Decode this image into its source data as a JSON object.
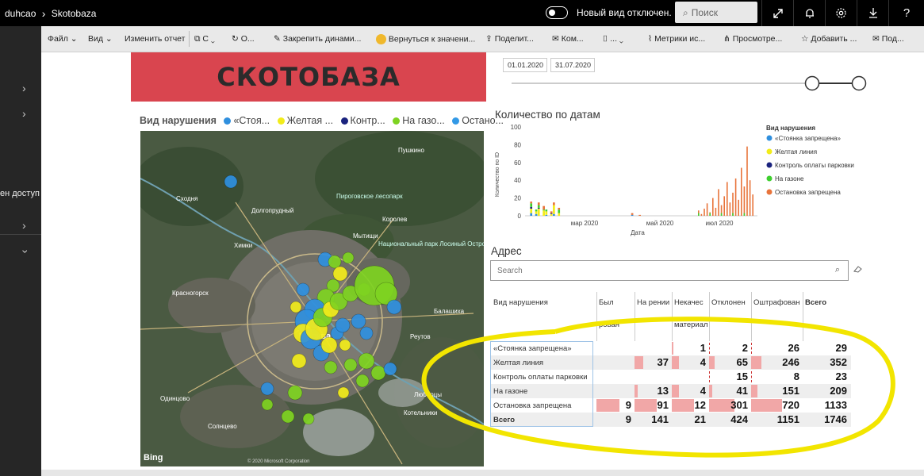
{
  "topbar": {
    "workspace": "duhcao",
    "separator": "›",
    "report": "Skotobaza",
    "toggle_label": "Новый вид отключен.",
    "search_placeholder": "Поиск"
  },
  "toolbar": {
    "items": [
      "Файл",
      "Вид",
      "Изменить отчет",
      "С",
      "О...",
      "Закрепить динами...",
      "Вернуться к значени...",
      "Поделит...",
      "Ком...",
      "...",
      "Метрики ис...",
      "Просмотре...",
      "Добавить ...",
      "Под..."
    ]
  },
  "left_rail": {
    "text": "ен доступ"
  },
  "banner": {
    "title": "СКОТОБАЗА"
  },
  "map": {
    "legend_title": "Вид нарушения",
    "legend_items": [
      "«Стоя...",
      "Желтая ...",
      "Контр...",
      "На газо...",
      "Остано..."
    ],
    "legend_colors": [
      "#2f8fde",
      "#f2ec1a",
      "#1a237e",
      "#7ed321",
      "#3399e6"
    ],
    "labels": [
      "Москва",
      "Химки",
      "Долгопрудный",
      "Мытищи",
      "Королев",
      "Пушкино",
      "Красногорск",
      "Одинцово",
      "Балашиха",
      "Реутов",
      "Люберцы",
      "Котельники",
      "Пироговское лесопарк",
      "Национальный парк Лосиный Остров",
      "Сходня",
      "Солнцево"
    ],
    "logo": "Bing",
    "copyright": "© 2020 Microsoft Corporation"
  },
  "slicer": {
    "start_date": "01.01.2020",
    "end_date": "31.07.2020"
  },
  "chart_data": {
    "type": "bar",
    "title": "Количество по датам",
    "xlabel": "Дата",
    "ylabel": "Количество по ID",
    "ylim": [
      0,
      100
    ],
    "y_ticks": [
      0,
      20,
      40,
      60,
      80,
      100
    ],
    "x_ticks": [
      "мар 2020",
      "май 2020",
      "июл 2020"
    ],
    "legend_title": "Вид нарушения",
    "legend_position": "right",
    "stacked": true,
    "series": [
      {
        "name": "«Стоянка запрещена»",
        "color": "#2f8fde",
        "values": [
          0,
          0,
          3,
          0,
          2,
          0,
          0,
          0,
          1,
          0,
          0,
          2,
          0,
          0,
          0,
          0,
          0,
          0,
          0,
          0,
          0,
          0,
          0,
          0,
          0,
          0,
          0,
          0,
          0,
          0,
          0,
          0,
          0,
          0,
          0,
          0,
          0,
          0,
          0,
          0,
          0,
          0,
          1,
          0,
          0,
          0,
          0,
          0,
          0,
          0,
          0,
          0,
          0,
          0,
          0,
          0,
          0,
          0,
          0,
          0,
          0,
          0,
          0,
          0,
          0,
          0,
          0,
          0,
          0,
          0,
          0,
          0,
          0,
          0,
          0,
          0,
          0,
          0,
          0,
          0,
          0,
          0,
          0,
          0,
          0,
          0,
          0,
          0,
          0,
          0,
          0,
          0
        ]
      },
      {
        "name": "Желтая линия",
        "color": "#f2ec1a",
        "values": [
          0,
          0,
          5,
          0,
          3,
          8,
          0,
          6,
          4,
          0,
          2,
          10,
          0,
          3,
          0,
          0,
          0,
          0,
          0,
          0,
          0,
          0,
          0,
          0,
          0,
          0,
          0,
          0,
          0,
          0,
          0,
          0,
          0,
          0,
          0,
          0,
          0,
          0,
          0,
          0,
          0,
          0,
          0,
          0,
          0,
          0,
          0,
          0,
          0,
          0,
          0,
          0,
          0,
          0,
          0,
          0,
          0,
          0,
          0,
          0,
          0,
          0,
          0,
          0,
          0,
          0,
          0,
          0,
          0,
          0,
          0,
          0,
          0,
          0,
          0,
          0,
          0,
          0,
          0,
          0,
          0,
          0,
          0,
          0,
          0,
          0,
          0,
          0,
          0,
          0,
          0,
          0
        ]
      },
      {
        "name": "Контроль оплаты парковки",
        "color": "#1a237e",
        "values": [
          0,
          0,
          2,
          0,
          0,
          1,
          0,
          0,
          0,
          0,
          1,
          0,
          0,
          0,
          0,
          0,
          0,
          0,
          0,
          0,
          0,
          0,
          0,
          0,
          0,
          0,
          0,
          0,
          0,
          0,
          0,
          0,
          0,
          0,
          0,
          0,
          0,
          0,
          0,
          0,
          0,
          0,
          0,
          0,
          0,
          0,
          0,
          0,
          0,
          0,
          0,
          0,
          0,
          0,
          0,
          0,
          0,
          0,
          0,
          0,
          0,
          0,
          0,
          0,
          0,
          0,
          0,
          0,
          0,
          0,
          0,
          0,
          0,
          0,
          0,
          0,
          0,
          0,
          0,
          0,
          0,
          0,
          0,
          0,
          0,
          0,
          0,
          0,
          0,
          0,
          0,
          0
        ]
      },
      {
        "name": "На газоне",
        "color": "#3fcf2f",
        "values": [
          0,
          0,
          4,
          0,
          2,
          3,
          0,
          1,
          2,
          0,
          0,
          0,
          0,
          4,
          0,
          0,
          0,
          0,
          0,
          0,
          0,
          0,
          0,
          0,
          0,
          0,
          0,
          0,
          0,
          0,
          0,
          0,
          0,
          0,
          0,
          0,
          0,
          0,
          0,
          0,
          0,
          0,
          0,
          0,
          0,
          0,
          0,
          0,
          0,
          0,
          0,
          0,
          0,
          0,
          0,
          0,
          0,
          0,
          0,
          0,
          0,
          0,
          0,
          0,
          0,
          0,
          0,
          0,
          0,
          0,
          0,
          0,
          0,
          0,
          0,
          0,
          0,
          0,
          0,
          0,
          0,
          0,
          0,
          0,
          0,
          0,
          0,
          0,
          0,
          0,
          0,
          0
        ]
      },
      {
        "name": "Остановка запрещена",
        "color": "#e8743b",
        "values": [
          0,
          0,
          2,
          0,
          0,
          3,
          0,
          4,
          0,
          0,
          2,
          3,
          0,
          2,
          0,
          0,
          0,
          0,
          0,
          0,
          0,
          0,
          0,
          0,
          0,
          0,
          0,
          0,
          0,
          0,
          0,
          0,
          0,
          0,
          0,
          0,
          0,
          0,
          0,
          0,
          0,
          0,
          2,
          0,
          0,
          1,
          0,
          0,
          0,
          0,
          0,
          0,
          0,
          0,
          0,
          0,
          0,
          0,
          0,
          0,
          0,
          0,
          0,
          0,
          0,
          0,
          0,
          0,
          0,
          0,
          0,
          0,
          0,
          0,
          0,
          0,
          0,
          0,
          0,
          0,
          0,
          0,
          0,
          0,
          0,
          0,
          0,
          0,
          0,
          0,
          0,
          0
        ]
      }
    ]
  },
  "address": {
    "title": "Адрес",
    "search_placeholder": "Search"
  },
  "matrix": {
    "row_header": "Вид нарушения",
    "columns": [
      "Был рован ранее",
      "На рении",
      "Некачес материал",
      "Отклонен",
      "Оштрафован",
      "Всего"
    ],
    "rows": [
      {
        "label": "«Стоянка запрещена»",
        "values": [
          null,
          null,
          1,
          2,
          26,
          29
        ]
      },
      {
        "label": "Желтая линия",
        "values": [
          null,
          37,
          4,
          65,
          246,
          352
        ]
      },
      {
        "label": "Контроль оплаты парковки",
        "values": [
          null,
          null,
          null,
          15,
          8,
          23
        ]
      },
      {
        "label": "На газоне",
        "values": [
          null,
          13,
          4,
          41,
          151,
          209
        ]
      },
      {
        "label": "Остановка запрещена",
        "values": [
          9,
          91,
          12,
          301,
          720,
          1133
        ]
      }
    ],
    "total": {
      "label": "Всего",
      "values": [
        9,
        141,
        21,
        424,
        1151,
        1746
      ]
    }
  }
}
